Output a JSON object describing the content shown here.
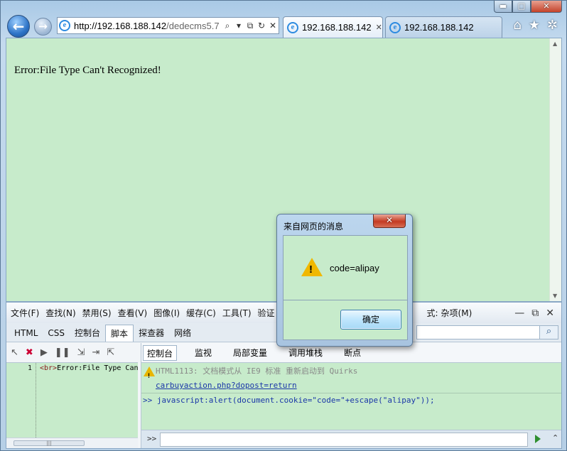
{
  "browser": {
    "url_host": "http://192.168.188.142",
    "url_rest": "/dedecms5.7",
    "tabs": [
      {
        "label": "192.168.188.142"
      },
      {
        "label": "192.168.188.142"
      }
    ]
  },
  "page": {
    "content_text": "Error:File Type Can't Recognized!",
    "background_color": "#c7ebcb"
  },
  "devtools": {
    "menu": [
      "文件(F)",
      "查找(N)",
      "禁用(S)",
      "查看(V)",
      "图像(I)",
      "缓存(C)",
      "工具(T)",
      "验证"
    ],
    "menu_right": [
      "式:",
      "杂项(M)"
    ],
    "tabs": [
      "HTML",
      "CSS",
      "控制台",
      "脚本",
      "探查器",
      "网络"
    ],
    "active_tab": "脚本",
    "console_tabs": [
      "控制台",
      "监视",
      "局部变量",
      "调用堆栈",
      "断点"
    ],
    "script": {
      "line_number": "1",
      "tag": "<br>",
      "code": "Error:File Type Can't Recognized!"
    },
    "console": {
      "warning": "HTML1113: 文档模式从 IE9 标准 重新启动到 Quirks",
      "link": "carbuyaction.php?dopost=return",
      "command": ">> javascript:alert(document.cookie=\"code=\"+escape(\"alipay\"));",
      "prompt": ">>"
    }
  },
  "dialog": {
    "title": "来自网页的消息",
    "message": "code=alipay",
    "ok_label": "确定"
  }
}
